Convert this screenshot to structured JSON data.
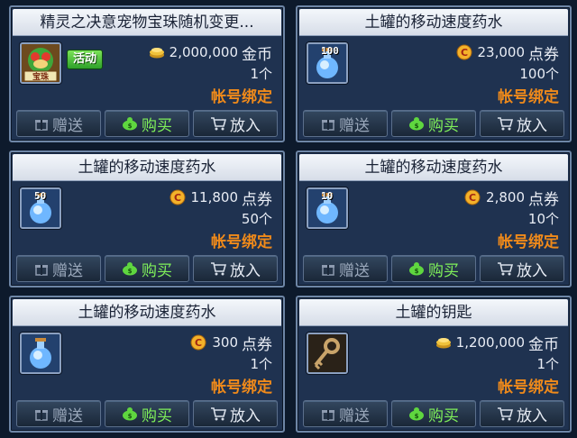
{
  "colors": {
    "bind": "#f08a1a",
    "buy": "#7ff05a",
    "frame": "#6e86a6"
  },
  "buttons": {
    "gift": "赠送",
    "buy": "购买",
    "cart": "放入"
  },
  "cards": [
    {
      "title": "精灵之决意宠物宝珠随机变更...",
      "icon": "pet-orb-icon",
      "badge": "活动",
      "currency_icon": "gold-coin-icon",
      "price": "2,000,000",
      "currency": "金币",
      "count": "1个",
      "bind": "帐号绑定"
    },
    {
      "title": "土罐的移动速度药水",
      "icon": "speed-potion-icon",
      "quantity": "100",
      "currency_icon": "cera-point-icon",
      "price": "23,000",
      "currency": "点券",
      "count": "100个",
      "bind": "帐号绑定"
    },
    {
      "title": "土罐的移动速度药水",
      "icon": "speed-potion-icon",
      "quantity": "50",
      "currency_icon": "cera-point-icon",
      "price": "11,800",
      "currency": "点券",
      "count": "50个",
      "bind": "帐号绑定"
    },
    {
      "title": "土罐的移动速度药水",
      "icon": "speed-potion-icon",
      "quantity": "10",
      "currency_icon": "cera-point-icon",
      "price": "2,800",
      "currency": "点券",
      "count": "10个",
      "bind": "帐号绑定"
    },
    {
      "title": "土罐的移动速度药水",
      "icon": "speed-potion-icon",
      "currency_icon": "cera-point-icon",
      "price": "300",
      "currency": "点券",
      "count": "1个",
      "bind": "帐号绑定"
    },
    {
      "title": "土罐的钥匙",
      "icon": "key-icon",
      "currency_icon": "gold-coin-icon",
      "price": "1,200,000",
      "currency": "金币",
      "count": "1个",
      "bind": "帐号绑定"
    }
  ]
}
